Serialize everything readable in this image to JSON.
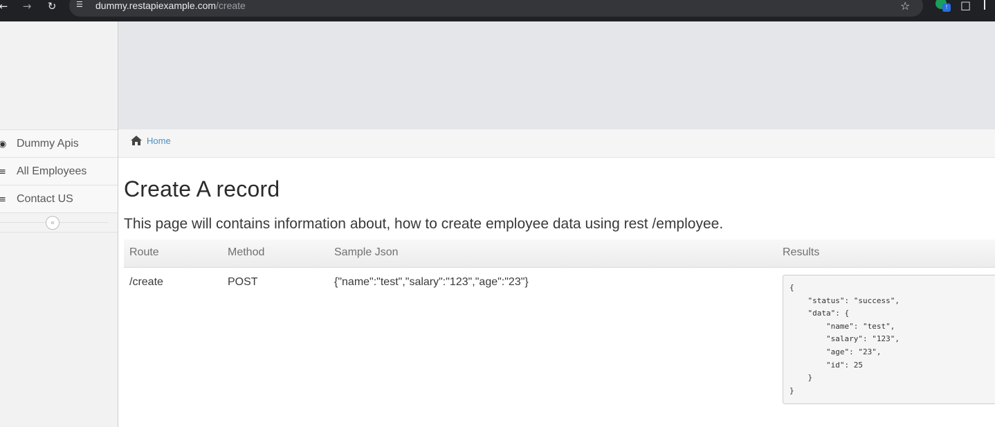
{
  "browser": {
    "url_host": "dummy.restapiexample.com",
    "url_path": "/create",
    "extension_badge": "!"
  },
  "sidebar": {
    "items": [
      {
        "label": "Dummy Apis",
        "icon": "dashboard-icon"
      },
      {
        "label": "All Employees",
        "icon": "list-icon"
      },
      {
        "label": "Contact US",
        "icon": "list-icon"
      }
    ],
    "collapse_icon": "double-chevron-left-icon"
  },
  "breadcrumb": {
    "home_label": "Home",
    "home_icon": "home-icon"
  },
  "page": {
    "title": "Create A record",
    "description": "This page will contains information about, how to create employee data using rest /employee."
  },
  "table": {
    "headers": [
      "Route",
      "Method",
      "Sample Json",
      "Results"
    ],
    "rows": [
      {
        "route": "/create",
        "method": "POST",
        "sample_json": "{\"name\":\"test\",\"salary\":\"123\",\"age\":\"23\"}",
        "result": "{\n    \"status\": \"success\",\n    \"data\": {\n        \"name\": \"test\",\n        \"salary\": \"123\",\n        \"age\": \"23\",\n        \"id\": 25\n    }\n}"
      }
    ]
  },
  "colors": {
    "link": "#4c8fbd",
    "top_band": "#e4e6e9",
    "sidebar_bg": "#f2f2f2"
  }
}
